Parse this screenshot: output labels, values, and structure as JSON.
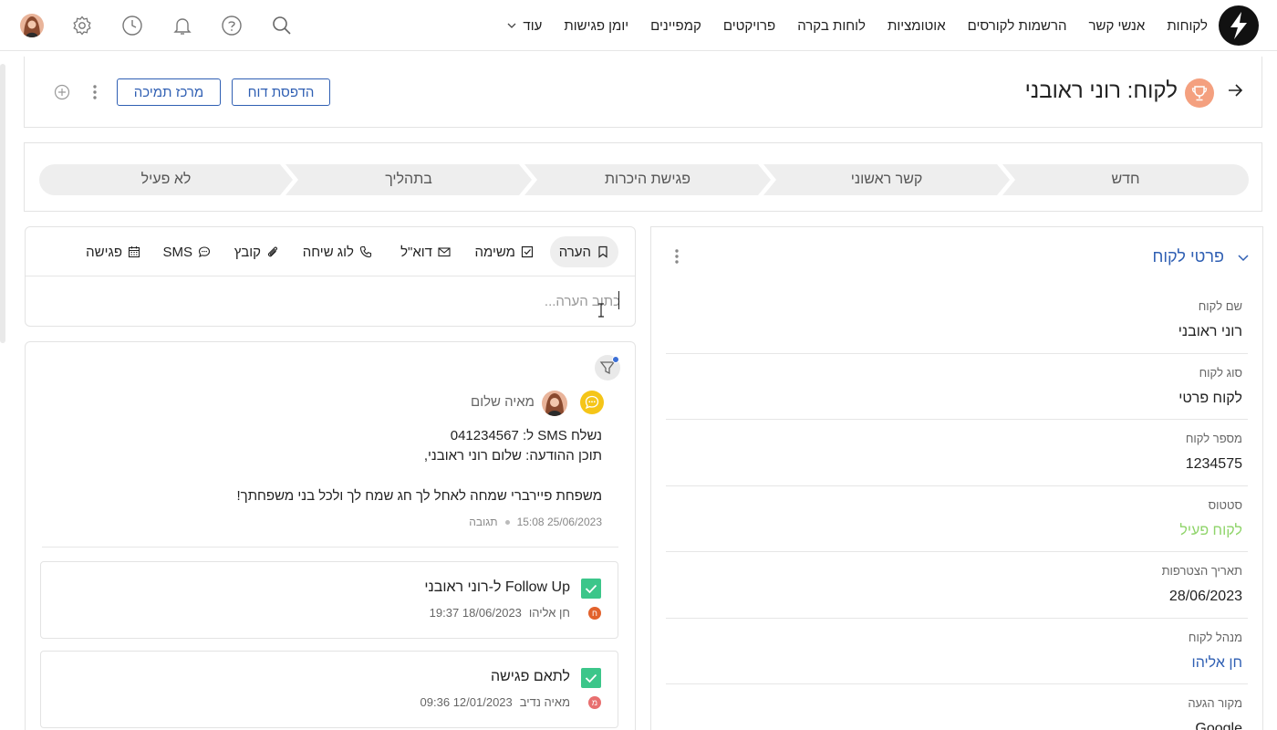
{
  "nav": {
    "items": [
      "לקוחות",
      "אנשי קשר",
      "הרשמות לקורסים",
      "אוטומציות",
      "לוחות בקרה",
      "פרויקטים",
      "קמפיינים",
      "יומן פגישות"
    ],
    "more_label": "עוד",
    "icons": [
      "search-icon",
      "help-icon",
      "bell-icon",
      "clock-icon",
      "gear-icon",
      "user-avatar"
    ]
  },
  "header": {
    "title": "לקוח: רוני ראובני",
    "print_label": "הדפסת דוח",
    "support_label": "מרכז תמיכה"
  },
  "pipeline": {
    "stages": [
      "חדש",
      "קשר ראשוני",
      "פגישת היכרות",
      "בתהליך",
      "לא פעיל"
    ]
  },
  "details": {
    "section_title": "פרטי לקוח",
    "fields": [
      {
        "label": "שם לקוח",
        "value": "רוני ראובני",
        "color": "#222222"
      },
      {
        "label": "סוג לקוח",
        "value": "לקוח פרטי",
        "color": "#222222"
      },
      {
        "label": "מספר לקוח",
        "value": "1234575",
        "color": "#222222"
      },
      {
        "label": "סטטוס",
        "value": "לקוח פעיל",
        "color": "#8fd46a"
      },
      {
        "label": "תאריך הצטרפות",
        "value": "28/06/2023",
        "color": "#222222"
      },
      {
        "label": "מנהל לקוח",
        "value": "חן אליהו",
        "color": "#2f5fb3"
      },
      {
        "label": "מקור הגעה",
        "value": "Google",
        "color": "#222222"
      }
    ]
  },
  "composer": {
    "tabs": [
      {
        "label": "הערה",
        "icon": "bookmark-icon",
        "active": true
      },
      {
        "label": "משימה",
        "icon": "checkbox-icon",
        "active": false
      },
      {
        "label": "דוא\"ל",
        "icon": "envelope-icon",
        "active": false
      },
      {
        "label": "לוג שיחה",
        "icon": "phone-icon",
        "active": false
      },
      {
        "label": "קובץ",
        "icon": "paperclip-icon",
        "active": false
      },
      {
        "label": "SMS",
        "icon": "chat-bubble-icon",
        "active": false
      },
      {
        "label": "פגישה",
        "icon": "calendar-icon",
        "active": false
      }
    ],
    "placeholder": "כתוב הערה..."
  },
  "feed": {
    "sms": {
      "author": "מאיה שלום",
      "line1": "נשלח SMS ל: 041234567",
      "line2": "תוכן ההודעה: שלום  רוני ראובני,",
      "line3": "משפחת פיירברי שמחה לאחל לך חג שמח לך ולכל בני משפחתך!",
      "datetime": "25/06/2023 15:08",
      "reply_label": "תגובה"
    },
    "tasks": [
      {
        "title": "Follow Up ל-רוני ראובני",
        "user": "חן אליהו",
        "initial": "ח",
        "initial_color": "#e2622c",
        "datetime": "18/06/2023 19:37"
      },
      {
        "title": "לתאם פגישה",
        "user": "מאיה נדיב",
        "initial": "מ",
        "initial_color": "#e86f6f",
        "datetime": "12/01/2023 09:36"
      }
    ]
  },
  "colors": {
    "accent": "#2f5fb3",
    "task_check": "#3cc68a",
    "sms_badge": "#f5c518",
    "trophy": "#f4a07f"
  }
}
